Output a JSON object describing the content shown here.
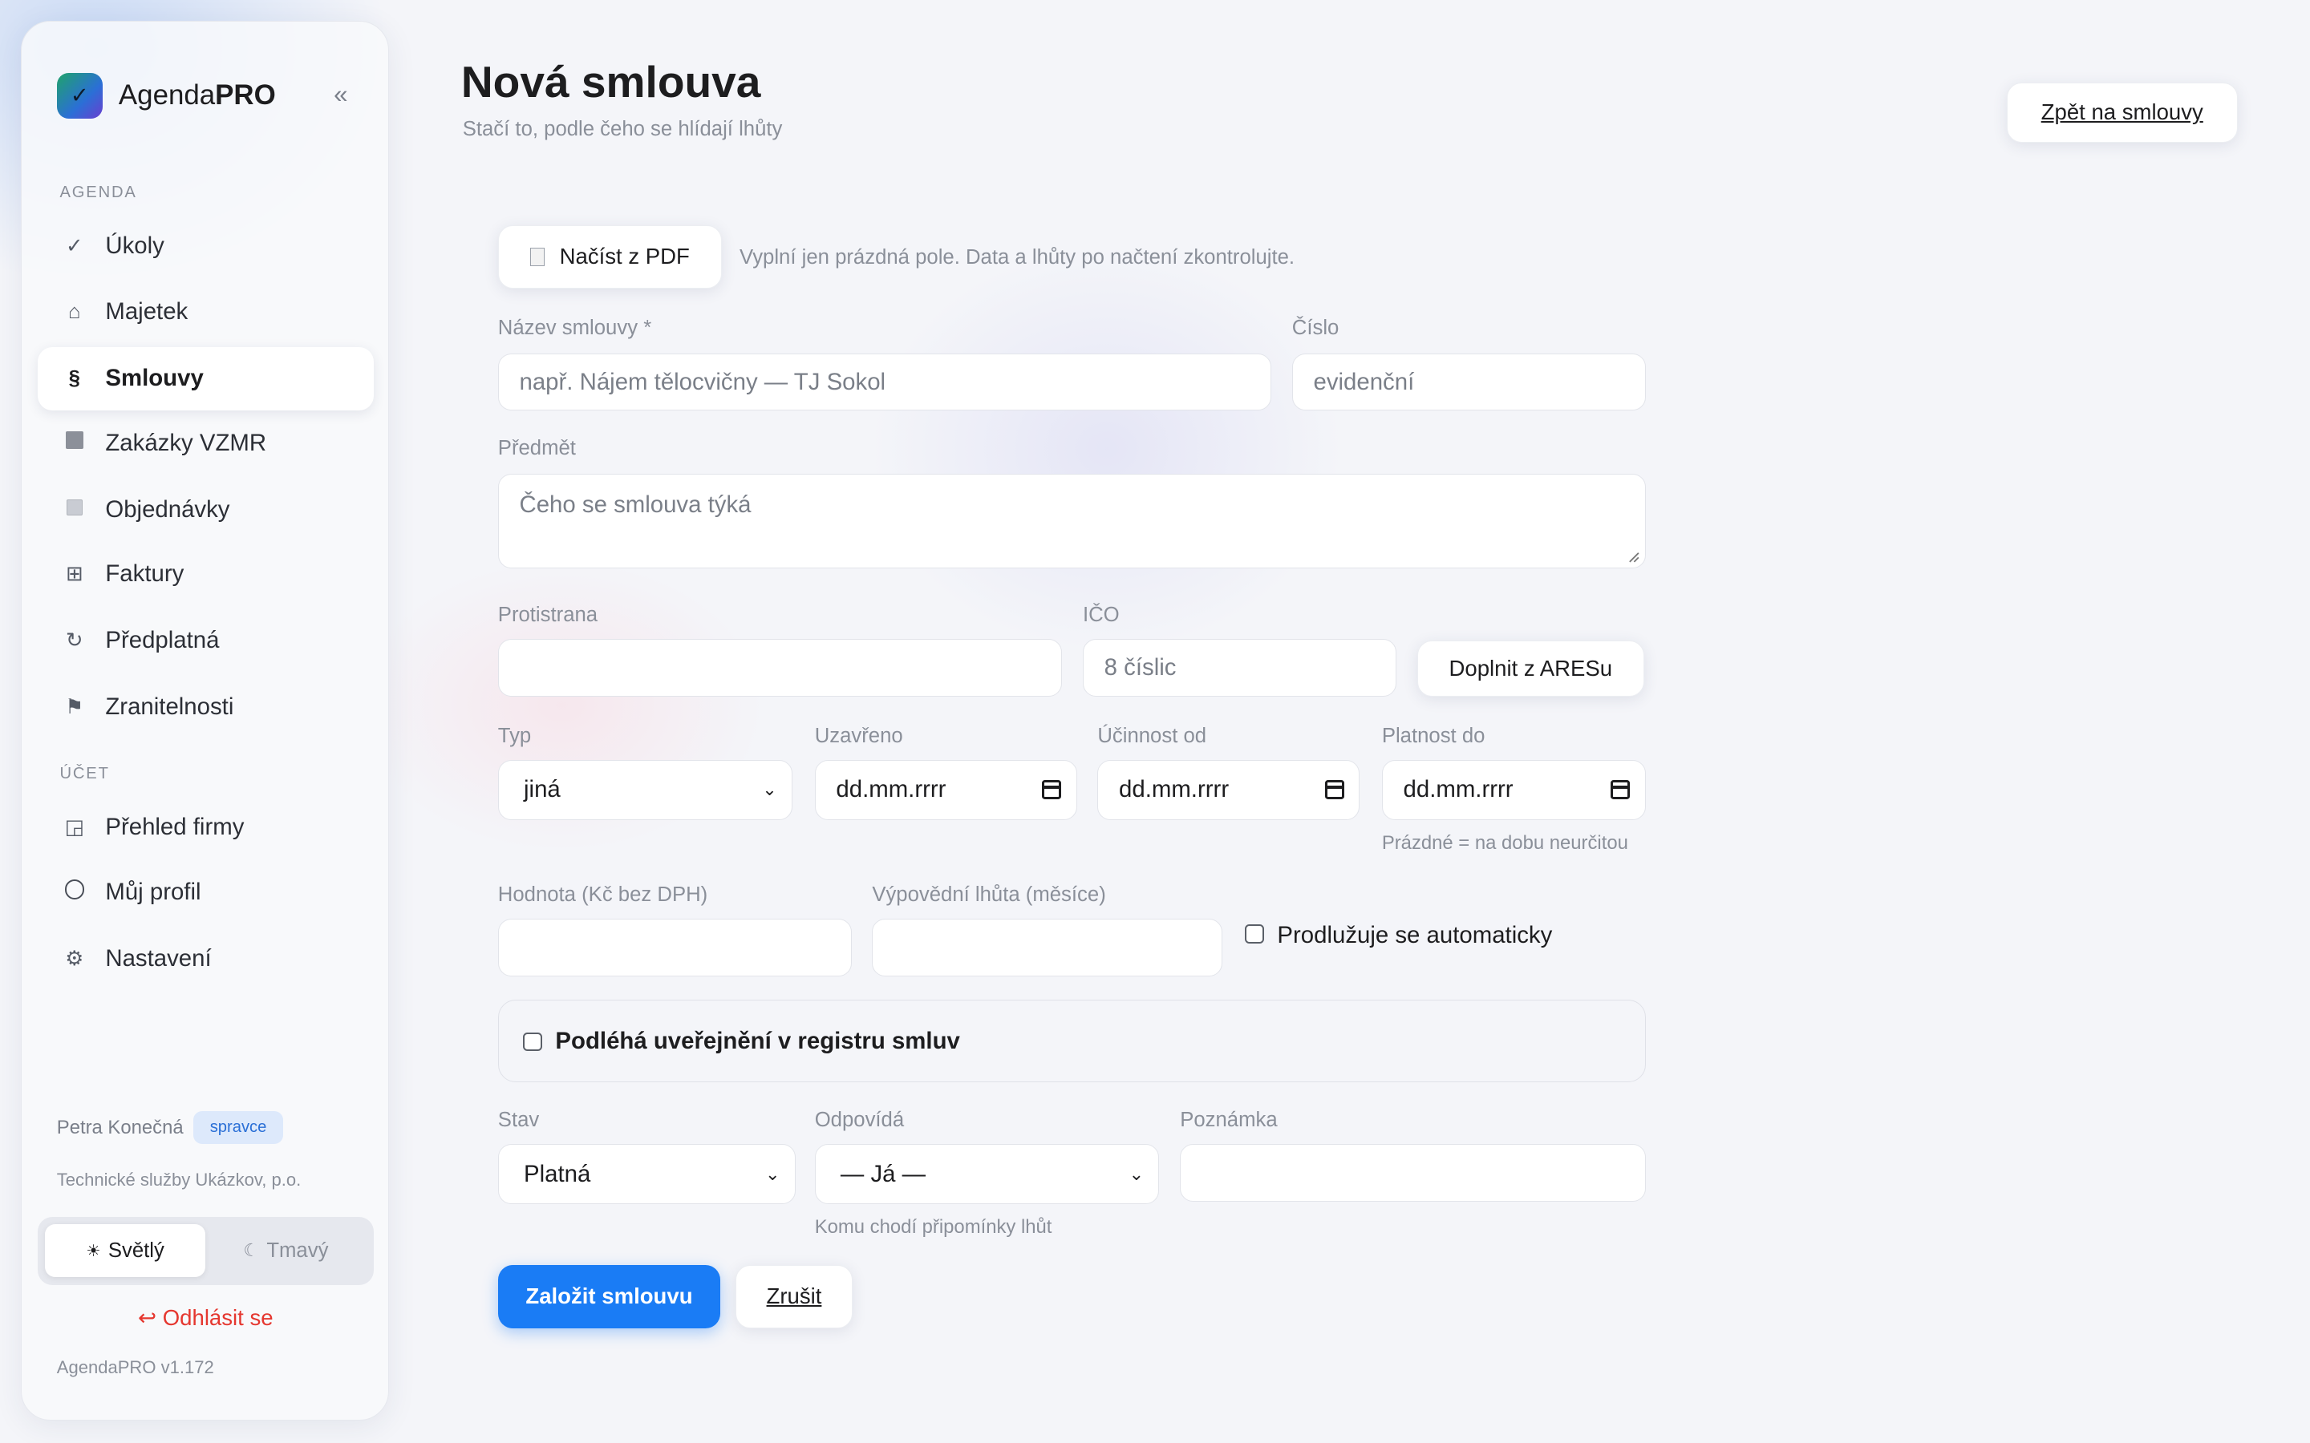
{
  "app": {
    "brand_prefix": "Agenda",
    "brand_suffix": "PRO",
    "version": "AgendaPRO v1.172"
  },
  "sidebar": {
    "sections": {
      "agenda": "AGENDA",
      "account": "ÚČET"
    },
    "agenda_items": [
      {
        "label": "Úkoly",
        "icon": "checkmark-icon"
      },
      {
        "label": "Majetek",
        "icon": "home-icon"
      },
      {
        "label": "Smlouvy",
        "icon": "paragraph-icon",
        "active": true
      },
      {
        "label": "Zakázky VZMR",
        "icon": "square-icon"
      },
      {
        "label": "Objednávky",
        "icon": "box-icon"
      },
      {
        "label": "Faktury",
        "icon": "grid-icon"
      },
      {
        "label": "Předplatná",
        "icon": "refresh-icon"
      },
      {
        "label": "Zranitelnosti",
        "icon": "flag-icon"
      }
    ],
    "account_items": [
      {
        "label": "Přehled firmy",
        "icon": "chart-icon"
      },
      {
        "label": "Můj profil",
        "icon": "profile-icon"
      },
      {
        "label": "Nastavení",
        "icon": "gear-icon"
      }
    ],
    "user": {
      "name": "Petra Konečná",
      "role": "spravce",
      "org": "Technické služby Ukázkov, p.o."
    },
    "theme": {
      "light": "Světlý",
      "dark": "Tmavý",
      "selected": "light"
    },
    "logout": "Odhlásit se"
  },
  "header": {
    "title": "Nová smlouva",
    "subtitle": "Stačí to, podle čeho se hlídají lhůty",
    "back_button": "Zpět na smlouvy"
  },
  "form": {
    "pdf_button": "Načíst z PDF",
    "pdf_hint": "Vyplní jen prázdná pole. Data a lhůty po načtení zkontrolujte.",
    "name": {
      "label": "Název smlouvy *",
      "placeholder": "např. Nájem tělocvičny — TJ Sokol",
      "value": ""
    },
    "number": {
      "label": "Číslo",
      "placeholder": "evidenční",
      "value": ""
    },
    "subject": {
      "label": "Předmět",
      "placeholder": "Čeho se smlouva týká",
      "value": ""
    },
    "counterparty": {
      "label": "Protistrana",
      "value": ""
    },
    "ico": {
      "label": "IČO",
      "placeholder": "8 číslic",
      "value": ""
    },
    "ares_button": "Doplnit z ARESu",
    "type": {
      "label": "Typ",
      "value": "jiná"
    },
    "concluded": {
      "label": "Uzavřeno",
      "value": "dd.mm.rrrr"
    },
    "effective_from": {
      "label": "Účinnost od",
      "value": "dd.mm.rrrr"
    },
    "valid_until": {
      "label": "Platnost do",
      "value": "dd.mm.rrrr",
      "hint": "Prázdné = na dobu neurčitou"
    },
    "value": {
      "label": "Hodnota (Kč bez DPH)",
      "value": ""
    },
    "notice_period": {
      "label": "Výpovědní lhůta (měsíce)",
      "value": ""
    },
    "auto_renew": {
      "label": "Prodlužuje se automaticky",
      "checked": false
    },
    "registry": {
      "label": "Podléhá uveřejnění v registru smluv",
      "checked": false
    },
    "status": {
      "label": "Stav",
      "value": "Platná"
    },
    "responsible": {
      "label": "Odpovídá",
      "value": "— Já —",
      "hint": "Komu chodí připomínky lhůt"
    },
    "note": {
      "label": "Poznámka",
      "value": ""
    },
    "submit_button": "Založit smlouvu",
    "cancel_button": "Zrušit"
  }
}
